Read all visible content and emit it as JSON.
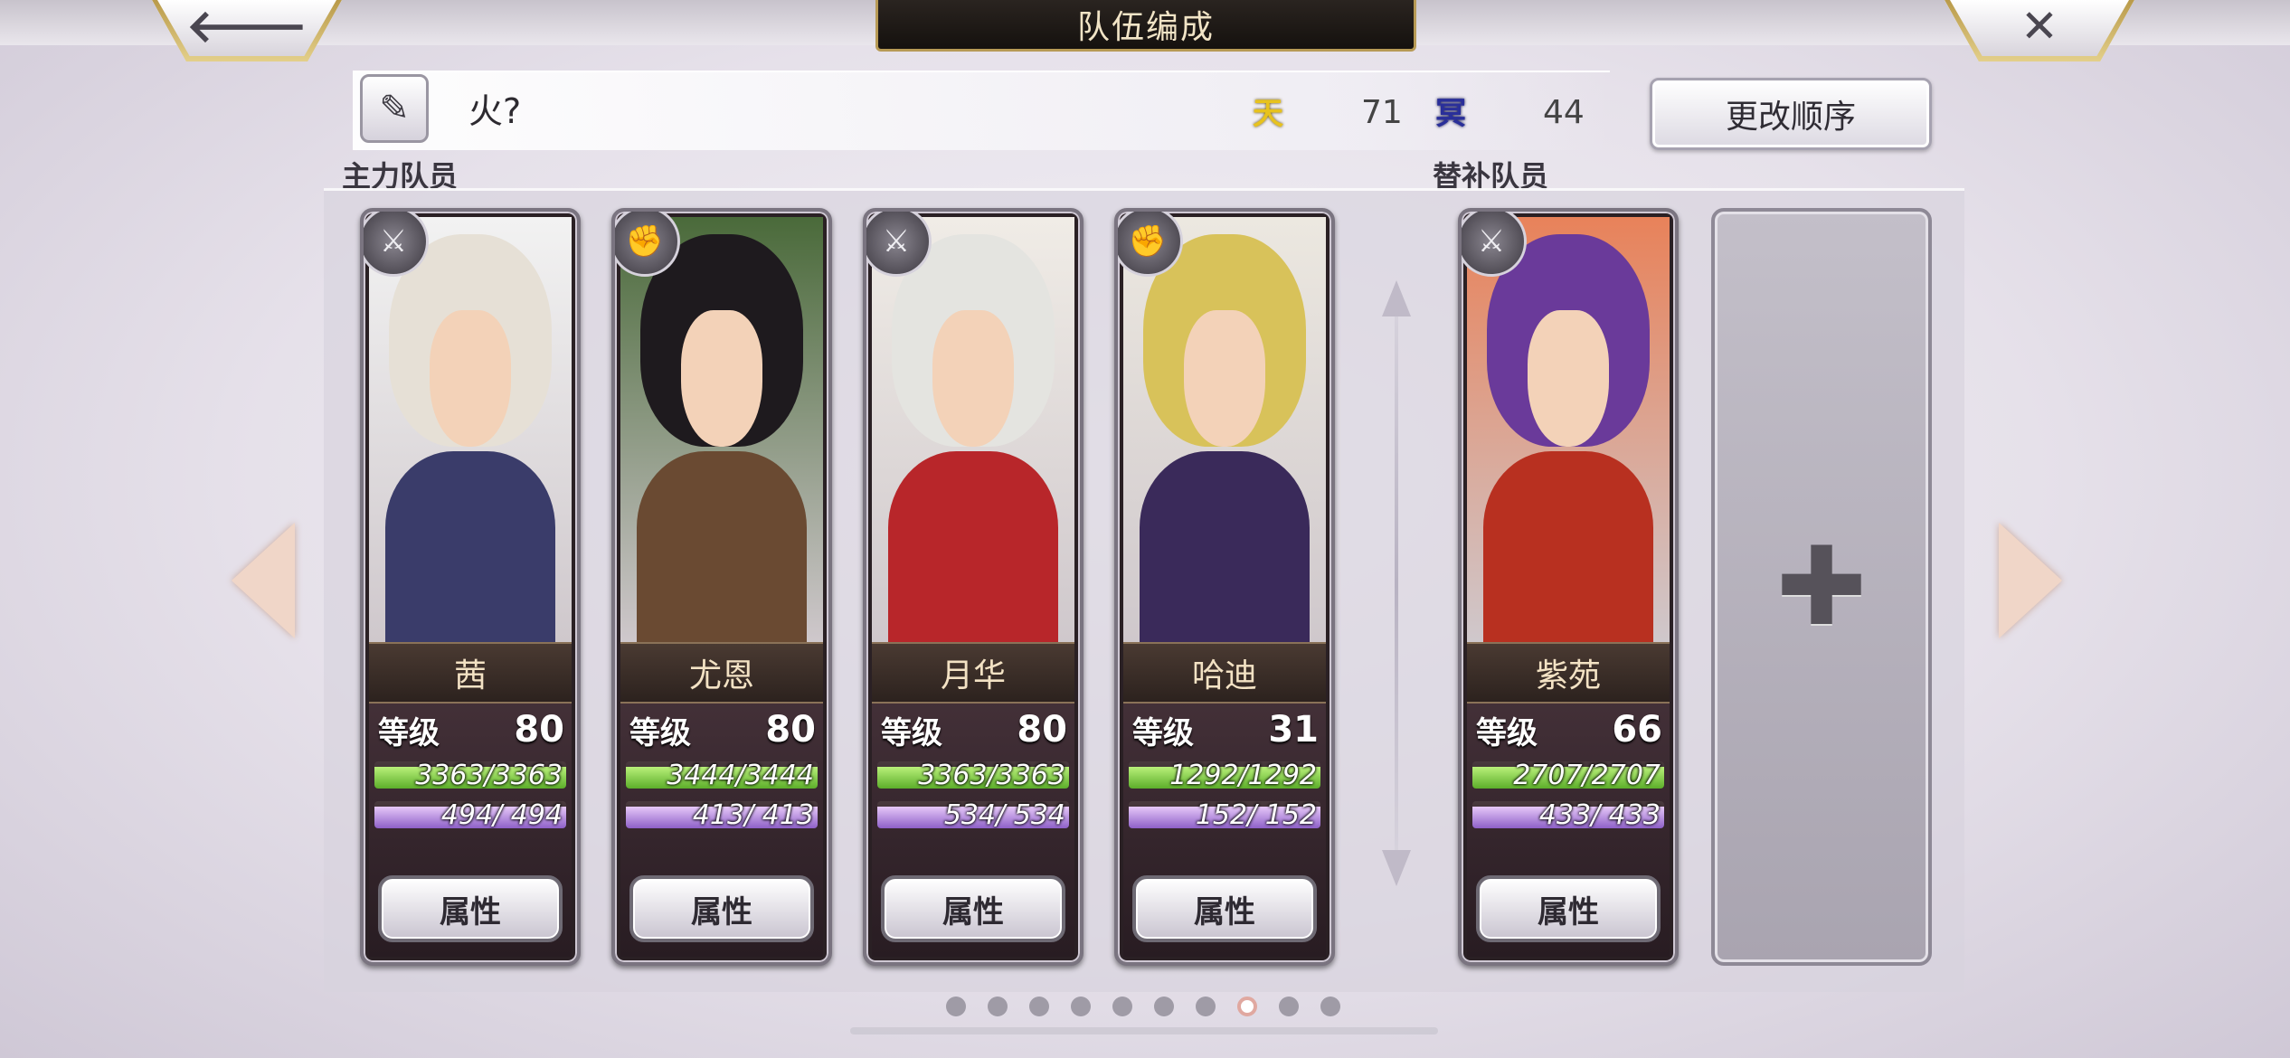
{
  "header": {
    "title": "队伍编成",
    "back_glyph": "🡐",
    "close_glyph": "✕"
  },
  "team": {
    "name": "火?",
    "edit_glyph": "✎",
    "heaven_label": "天",
    "heaven_value": "71",
    "nether_label": "冥",
    "nether_value": "44",
    "order_button": "更改顺序"
  },
  "sections": {
    "main": "主力队员",
    "sub": "替补队员"
  },
  "level_label": "等级",
  "attr_label": "属性",
  "members": [
    {
      "name": "茜",
      "level": "80",
      "hp": "3363/3363",
      "mp": "494/ 494",
      "hp_frac": 1,
      "mp_frac": 1,
      "weapon": "sword",
      "hair": "#e6e0d6",
      "body": "#3a3c6a",
      "bg": "#f2f2f2"
    },
    {
      "name": "尤恩",
      "level": "80",
      "hp": "3444/3444",
      "mp": "413/ 413",
      "hp_frac": 1,
      "mp_frac": 1,
      "weapon": "gauntlet",
      "hair": "#1e1a1e",
      "body": "#6a4a32",
      "bg": "#4a6a3a"
    },
    {
      "name": "月华",
      "level": "80",
      "hp": "3363/3363",
      "mp": "534/ 534",
      "hp_frac": 1,
      "mp_frac": 1,
      "weapon": "sword",
      "hair": "#e4e4e0",
      "body": "#b8262a",
      "bg": "#f0ece6"
    },
    {
      "name": "哈迪",
      "level": "31",
      "hp": "1292/1292",
      "mp": "152/ 152",
      "hp_frac": 1,
      "mp_frac": 1,
      "weapon": "gauntlet",
      "hair": "#d8c25a",
      "body": "#3a2a5a",
      "bg": "#ece8e0"
    }
  ],
  "reserves": [
    {
      "name": "紫苑",
      "level": "66",
      "hp": "2707/2707",
      "mp": "433/ 433",
      "hp_frac": 1,
      "mp_frac": 1,
      "weapon": "sword",
      "hair": "#6a3a9a",
      "body": "#b83020",
      "bg": "#e8825a"
    }
  ],
  "empty_slot": {
    "glyph": "✚"
  },
  "pager": {
    "count": 10,
    "active_index": 7
  },
  "colors": {
    "accent_gold": "#b79a55",
    "hp_green": "#5cae2a",
    "mp_purple": "#8e60c8"
  }
}
